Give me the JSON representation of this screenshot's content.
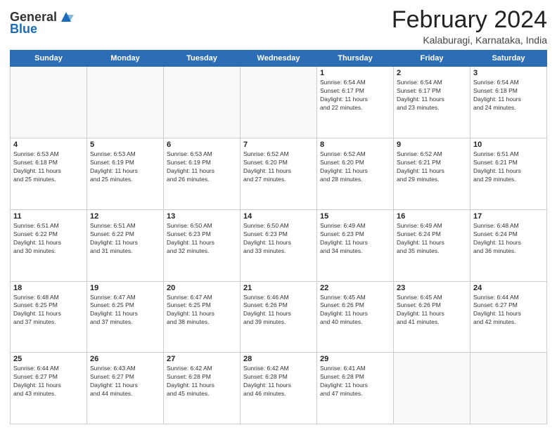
{
  "header": {
    "logo_general": "General",
    "logo_blue": "Blue",
    "title": "February 2024",
    "subtitle": "Kalaburagi, Karnataka, India"
  },
  "weekdays": [
    "Sunday",
    "Monday",
    "Tuesday",
    "Wednesday",
    "Thursday",
    "Friday",
    "Saturday"
  ],
  "weeks": [
    [
      {
        "day": "",
        "info": ""
      },
      {
        "day": "",
        "info": ""
      },
      {
        "day": "",
        "info": ""
      },
      {
        "day": "",
        "info": ""
      },
      {
        "day": "1",
        "info": "Sunrise: 6:54 AM\nSunset: 6:17 PM\nDaylight: 11 hours\nand 22 minutes."
      },
      {
        "day": "2",
        "info": "Sunrise: 6:54 AM\nSunset: 6:17 PM\nDaylight: 11 hours\nand 23 minutes."
      },
      {
        "day": "3",
        "info": "Sunrise: 6:54 AM\nSunset: 6:18 PM\nDaylight: 11 hours\nand 24 minutes."
      }
    ],
    [
      {
        "day": "4",
        "info": "Sunrise: 6:53 AM\nSunset: 6:18 PM\nDaylight: 11 hours\nand 25 minutes."
      },
      {
        "day": "5",
        "info": "Sunrise: 6:53 AM\nSunset: 6:19 PM\nDaylight: 11 hours\nand 25 minutes."
      },
      {
        "day": "6",
        "info": "Sunrise: 6:53 AM\nSunset: 6:19 PM\nDaylight: 11 hours\nand 26 minutes."
      },
      {
        "day": "7",
        "info": "Sunrise: 6:52 AM\nSunset: 6:20 PM\nDaylight: 11 hours\nand 27 minutes."
      },
      {
        "day": "8",
        "info": "Sunrise: 6:52 AM\nSunset: 6:20 PM\nDaylight: 11 hours\nand 28 minutes."
      },
      {
        "day": "9",
        "info": "Sunrise: 6:52 AM\nSunset: 6:21 PM\nDaylight: 11 hours\nand 29 minutes."
      },
      {
        "day": "10",
        "info": "Sunrise: 6:51 AM\nSunset: 6:21 PM\nDaylight: 11 hours\nand 29 minutes."
      }
    ],
    [
      {
        "day": "11",
        "info": "Sunrise: 6:51 AM\nSunset: 6:22 PM\nDaylight: 11 hours\nand 30 minutes."
      },
      {
        "day": "12",
        "info": "Sunrise: 6:51 AM\nSunset: 6:22 PM\nDaylight: 11 hours\nand 31 minutes."
      },
      {
        "day": "13",
        "info": "Sunrise: 6:50 AM\nSunset: 6:23 PM\nDaylight: 11 hours\nand 32 minutes."
      },
      {
        "day": "14",
        "info": "Sunrise: 6:50 AM\nSunset: 6:23 PM\nDaylight: 11 hours\nand 33 minutes."
      },
      {
        "day": "15",
        "info": "Sunrise: 6:49 AM\nSunset: 6:23 PM\nDaylight: 11 hours\nand 34 minutes."
      },
      {
        "day": "16",
        "info": "Sunrise: 6:49 AM\nSunset: 6:24 PM\nDaylight: 11 hours\nand 35 minutes."
      },
      {
        "day": "17",
        "info": "Sunrise: 6:48 AM\nSunset: 6:24 PM\nDaylight: 11 hours\nand 36 minutes."
      }
    ],
    [
      {
        "day": "18",
        "info": "Sunrise: 6:48 AM\nSunset: 6:25 PM\nDaylight: 11 hours\nand 37 minutes."
      },
      {
        "day": "19",
        "info": "Sunrise: 6:47 AM\nSunset: 6:25 PM\nDaylight: 11 hours\nand 37 minutes."
      },
      {
        "day": "20",
        "info": "Sunrise: 6:47 AM\nSunset: 6:25 PM\nDaylight: 11 hours\nand 38 minutes."
      },
      {
        "day": "21",
        "info": "Sunrise: 6:46 AM\nSunset: 6:26 PM\nDaylight: 11 hours\nand 39 minutes."
      },
      {
        "day": "22",
        "info": "Sunrise: 6:45 AM\nSunset: 6:26 PM\nDaylight: 11 hours\nand 40 minutes."
      },
      {
        "day": "23",
        "info": "Sunrise: 6:45 AM\nSunset: 6:26 PM\nDaylight: 11 hours\nand 41 minutes."
      },
      {
        "day": "24",
        "info": "Sunrise: 6:44 AM\nSunset: 6:27 PM\nDaylight: 11 hours\nand 42 minutes."
      }
    ],
    [
      {
        "day": "25",
        "info": "Sunrise: 6:44 AM\nSunset: 6:27 PM\nDaylight: 11 hours\nand 43 minutes."
      },
      {
        "day": "26",
        "info": "Sunrise: 6:43 AM\nSunset: 6:27 PM\nDaylight: 11 hours\nand 44 minutes."
      },
      {
        "day": "27",
        "info": "Sunrise: 6:42 AM\nSunset: 6:28 PM\nDaylight: 11 hours\nand 45 minutes."
      },
      {
        "day": "28",
        "info": "Sunrise: 6:42 AM\nSunset: 6:28 PM\nDaylight: 11 hours\nand 46 minutes."
      },
      {
        "day": "29",
        "info": "Sunrise: 6:41 AM\nSunset: 6:28 PM\nDaylight: 11 hours\nand 47 minutes."
      },
      {
        "day": "",
        "info": ""
      },
      {
        "day": "",
        "info": ""
      }
    ]
  ]
}
